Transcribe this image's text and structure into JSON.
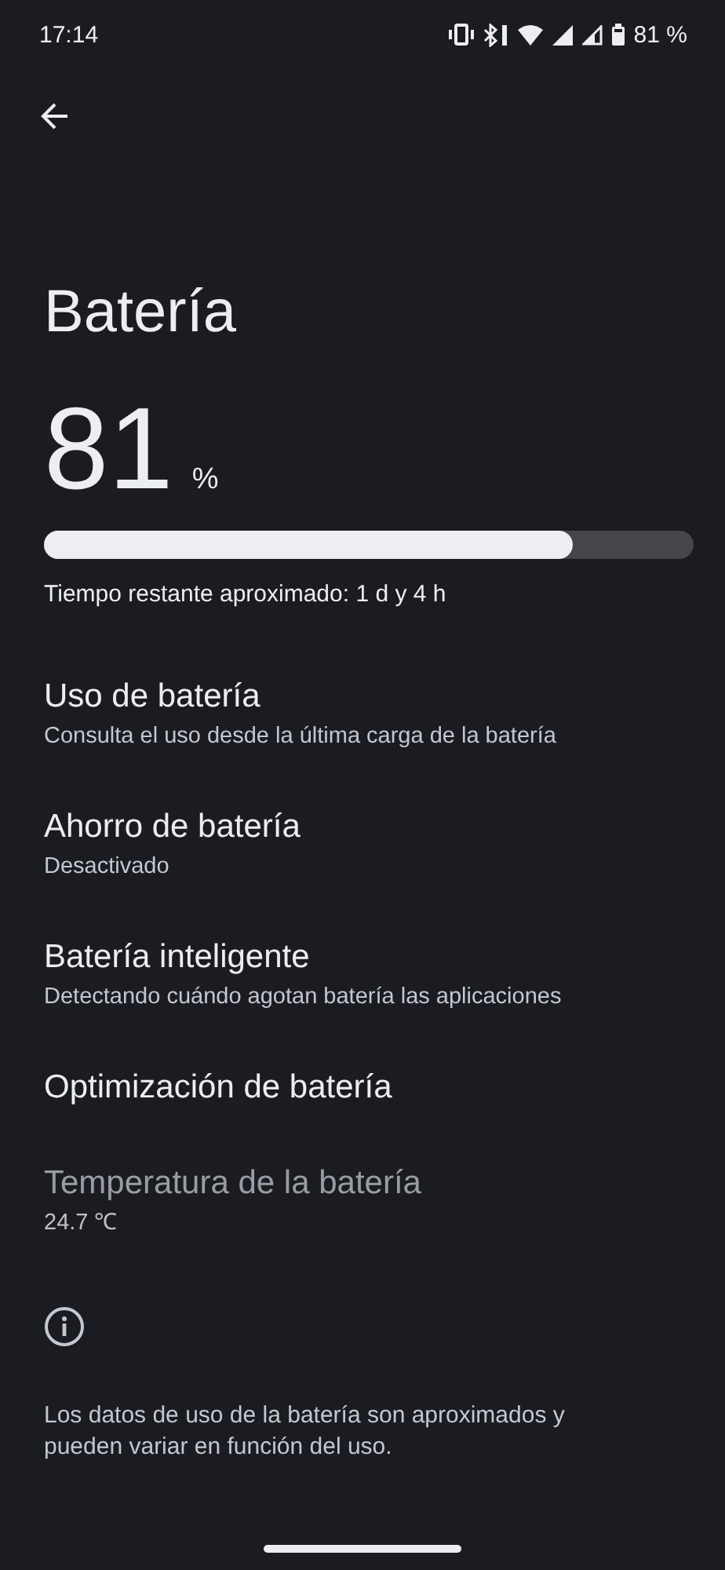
{
  "status_bar": {
    "time": "17:14",
    "battery_percent": "81 %"
  },
  "title": "Batería",
  "battery": {
    "value": "81",
    "unit": "%",
    "level": 0.815,
    "remaining": "Tiempo restante aproximado: 1 d y 4 h"
  },
  "items": [
    {
      "title": "Uso de batería",
      "summary": "Consulta el uso desde la última carga de la batería",
      "disabled": false
    },
    {
      "title": "Ahorro de batería",
      "summary": "Desactivado",
      "disabled": false
    },
    {
      "title": "Batería inteligente",
      "summary": "Detectando cuándo agotan batería las aplicaciones",
      "disabled": false
    },
    {
      "title": "Optimización de batería",
      "disabled": false
    },
    {
      "title": "Temperatura de la batería",
      "summary": "24.7 ℃",
      "disabled": true
    }
  ],
  "footer": "Los datos de uso de la batería son aproximados y pueden variar en función del uso."
}
